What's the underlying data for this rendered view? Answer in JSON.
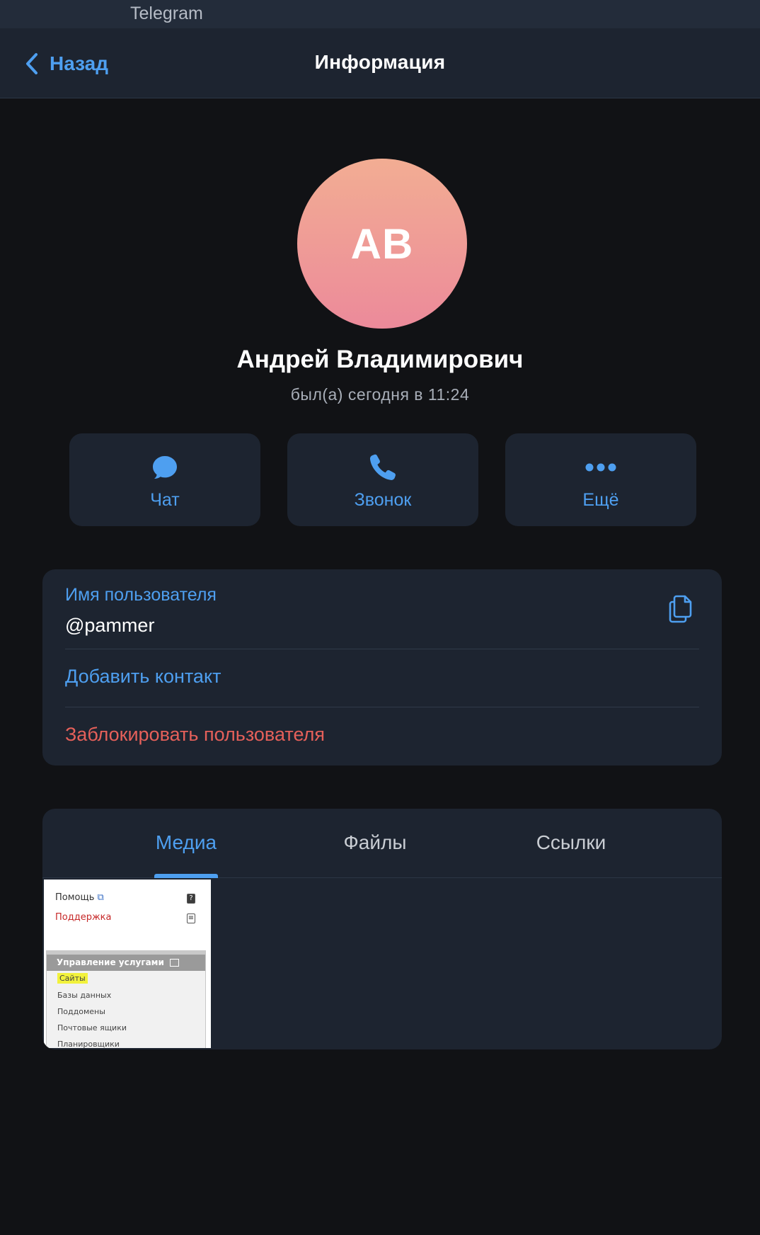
{
  "window": {
    "app_title": "Telegram"
  },
  "nav": {
    "back_label": "Назад",
    "title": "Информация"
  },
  "profile": {
    "initials": "AB",
    "name": "Андрей Владимирович",
    "status": "был(а) сегодня в 11:24",
    "avatar_gradient": [
      "#f2ad93",
      "#ec8a9a"
    ]
  },
  "actions": [
    {
      "label": "Чат",
      "icon": "chat-bubble-icon"
    },
    {
      "label": "Звонок",
      "icon": "phone-icon"
    },
    {
      "label": "Ещё",
      "icon": "more-dots-icon"
    }
  ],
  "info": {
    "username_label": "Имя пользователя",
    "username_value": "@pammer",
    "add_contact": "Добавить контакт",
    "block_user": "Заблокировать пользователя"
  },
  "media": {
    "tabs": [
      "Медиа",
      "Файлы",
      "Ссылки"
    ],
    "active_tab": "Медиа",
    "thumbnail": {
      "help": "Помощь",
      "support": "Поддержка",
      "section_title": "Управление услугами",
      "items": [
        "Сайты",
        "Базы данных",
        "Поддомены",
        "Почтовые ящики",
        "Планировщики"
      ]
    }
  },
  "colors": {
    "accent": "#4e9ff0",
    "danger": "#e5605a",
    "card_bg": "#1d2430",
    "page_bg": "#111215"
  }
}
